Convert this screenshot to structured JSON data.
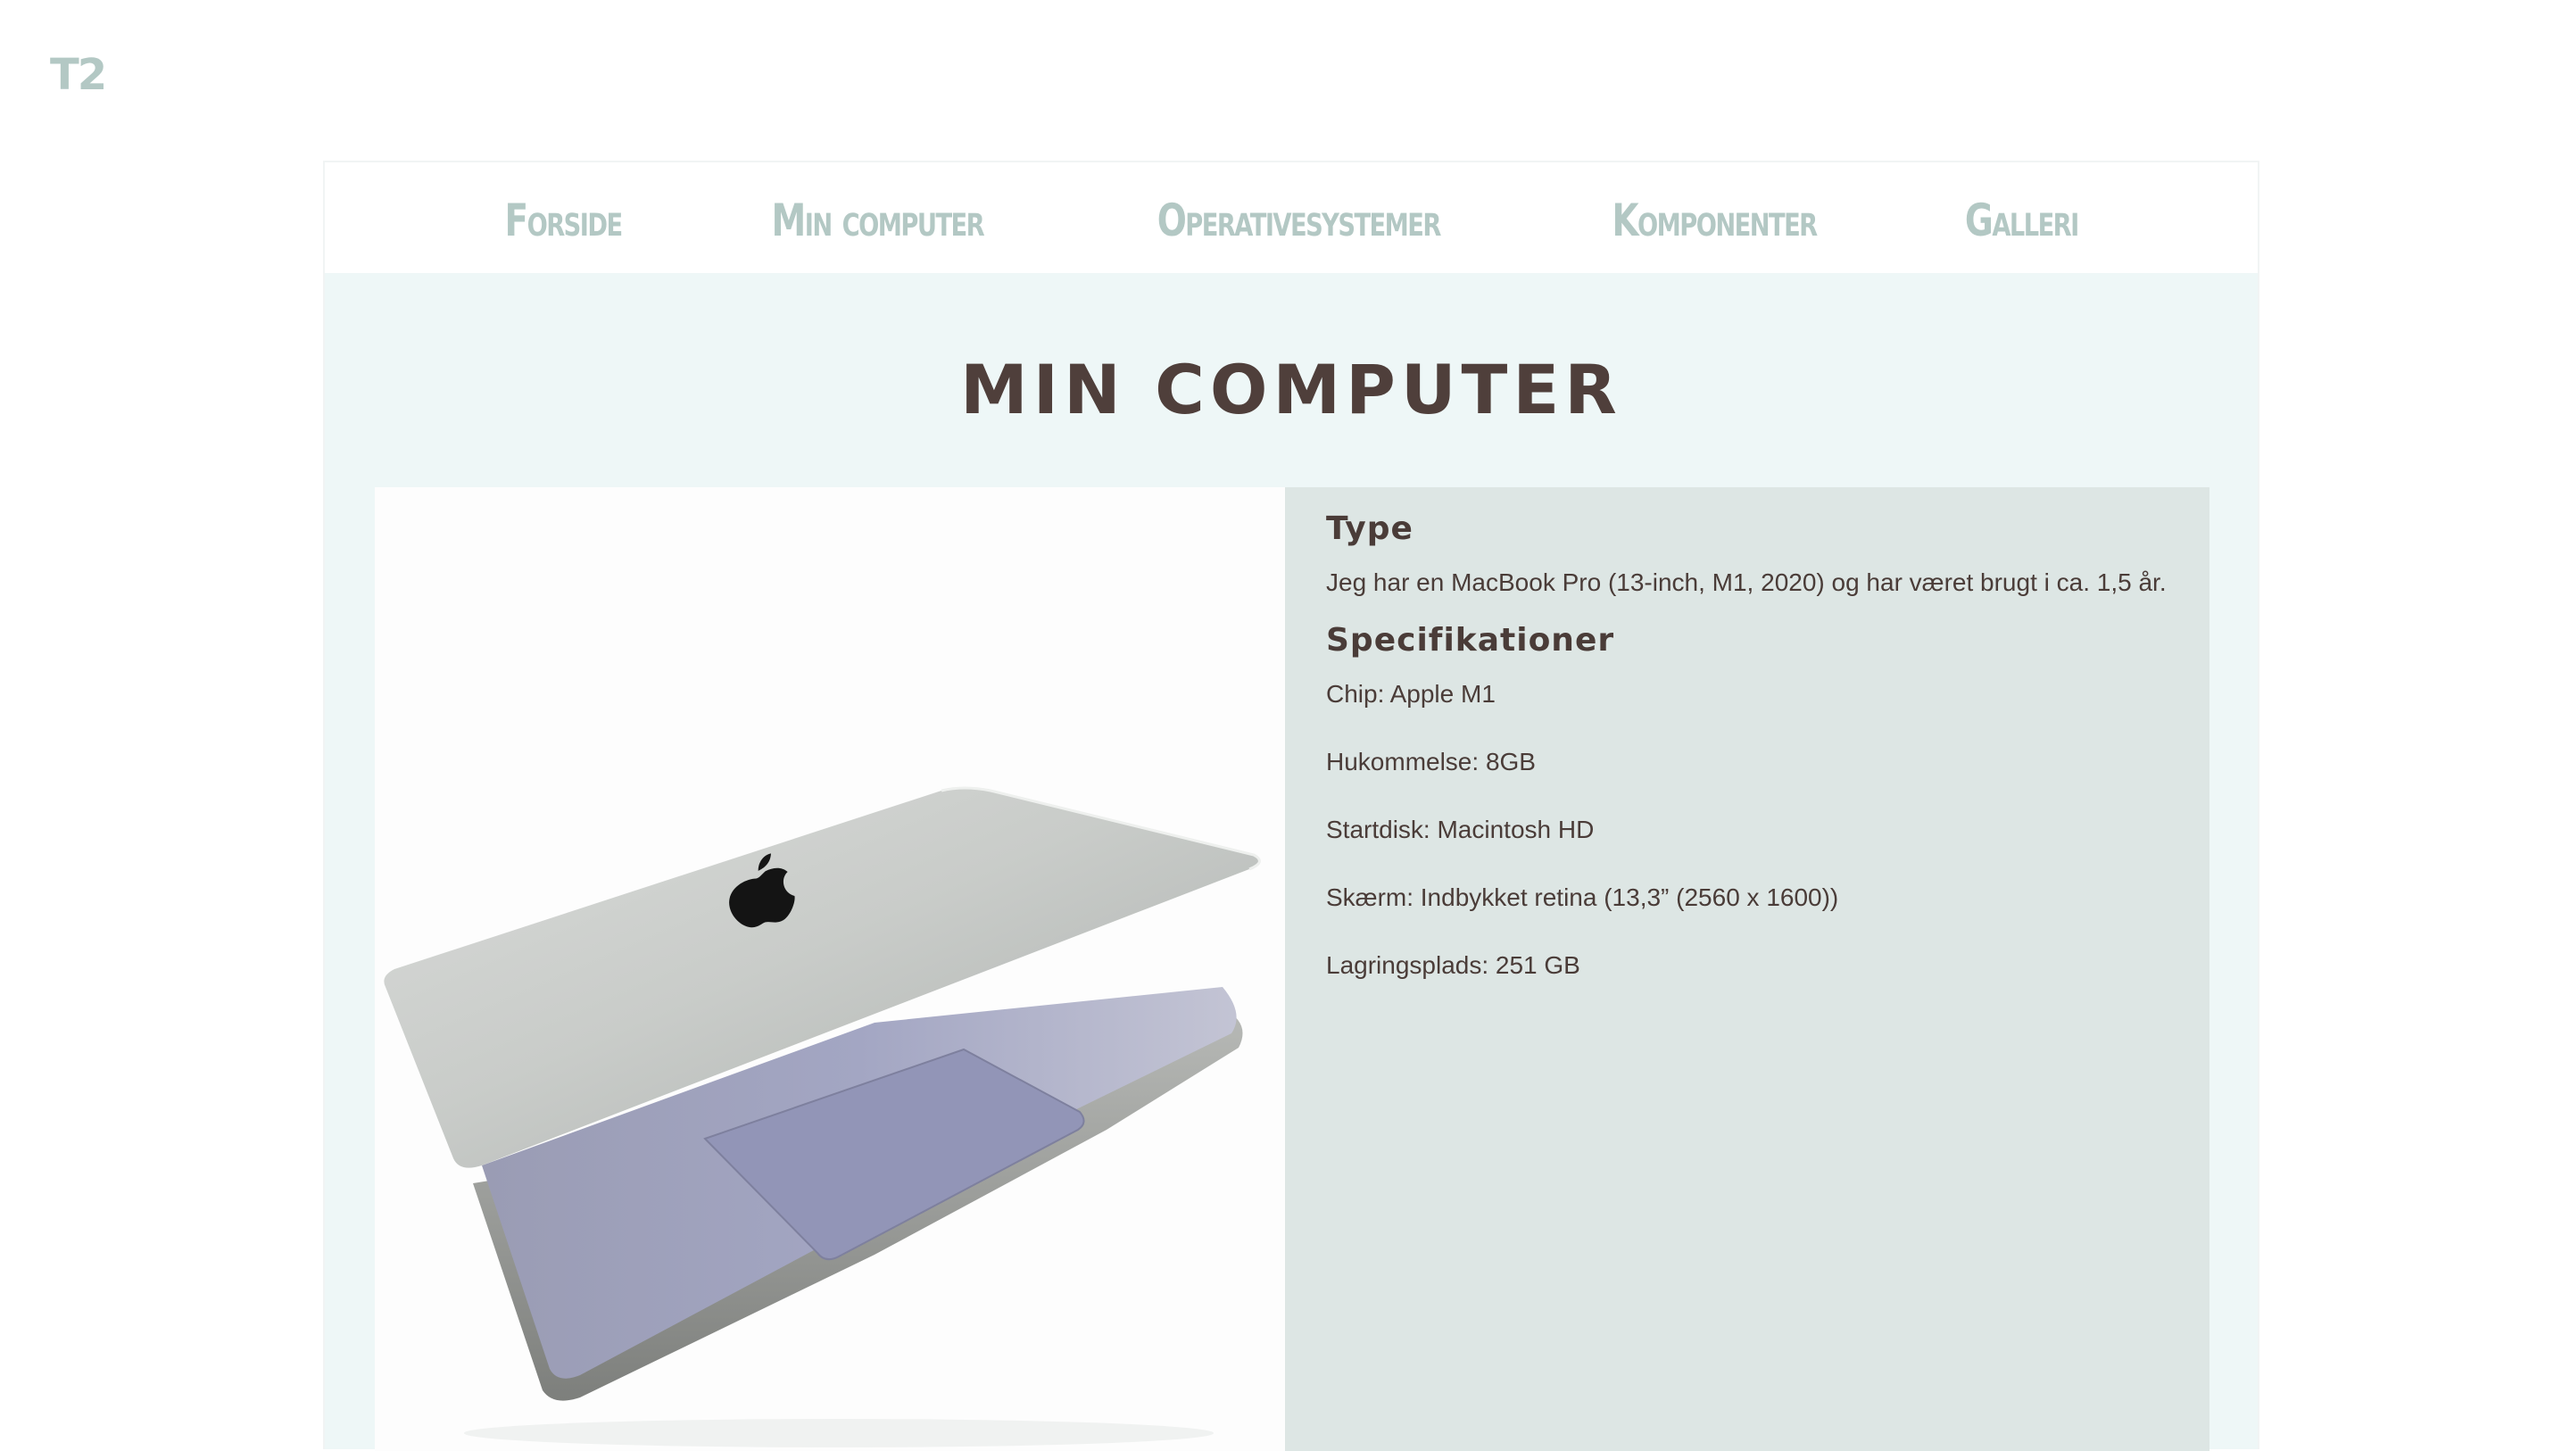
{
  "logo": "T2",
  "nav": {
    "items": [
      "Forside",
      "Min computer",
      "Operativesystemer",
      "Komponenter",
      "Galleri"
    ]
  },
  "page": {
    "title": "MIN COMPUTER"
  },
  "info": {
    "type_heading": "Type",
    "type_text": "Jeg har en MacBook Pro (13-inch, M1, 2020) og har været brugt i ca. 1,5 år.",
    "specs_heading": "Specifikationer",
    "specs": [
      "Chip: Apple M1",
      "Hukommelse: 8GB",
      "Startdisk: Macintosh HD",
      "Skærm: Indbykket retina (13,3” (2560 x 1600))",
      "Lagringsplads: 251 GB"
    ]
  },
  "colors": {
    "accent": "#b3c8c4",
    "title": "#4f3f3b",
    "panel": "#dde6e4",
    "background": "#eef7f7"
  },
  "icons": {
    "photo": "laptop-photo",
    "brand": "apple-logo-icon"
  }
}
